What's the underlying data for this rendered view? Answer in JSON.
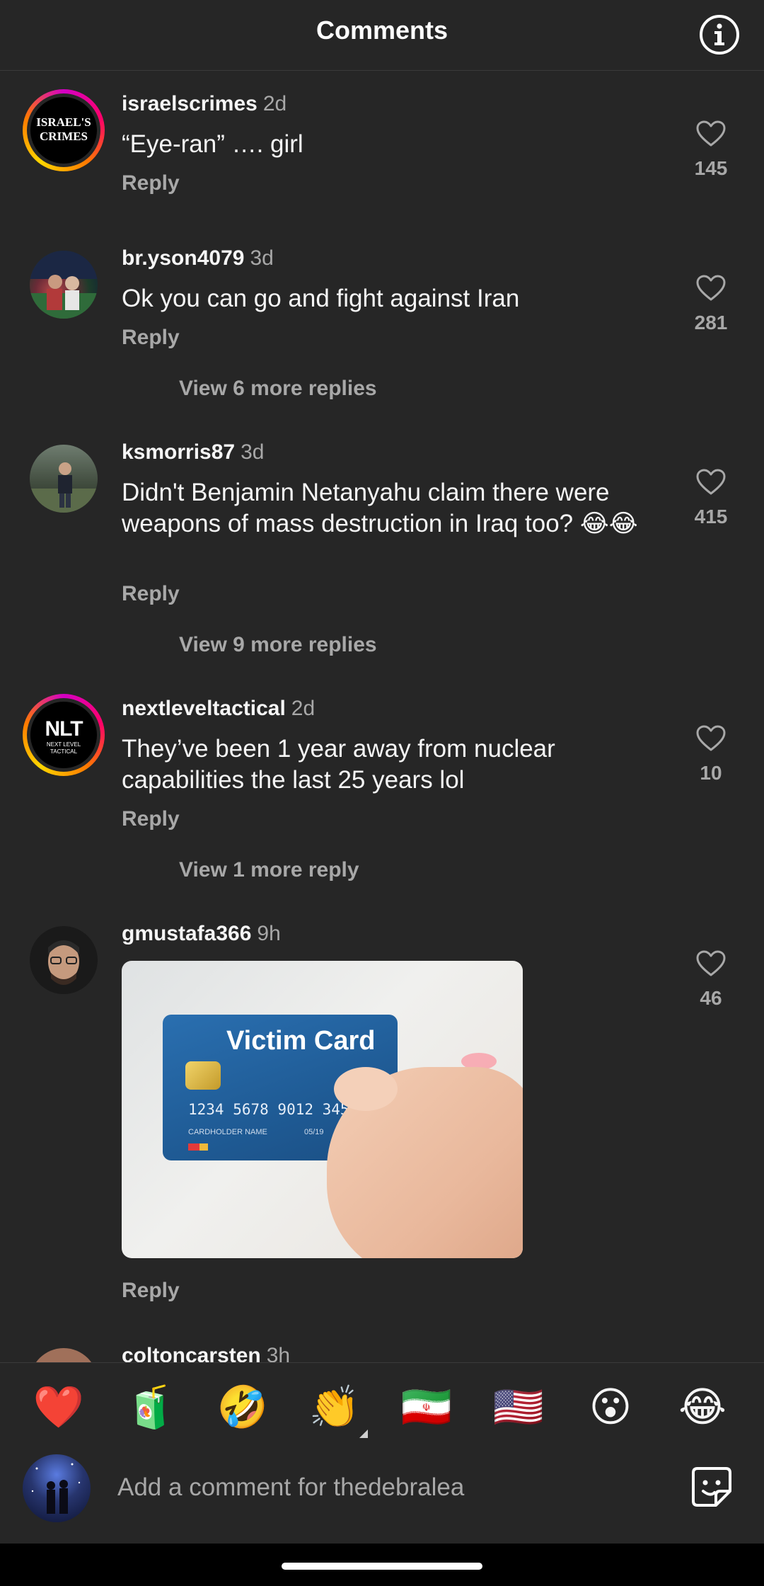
{
  "header": {
    "title": "Comments",
    "info_icon": "info-icon"
  },
  "comments": [
    {
      "user": "israelscrimes",
      "time": "2d",
      "text": "“Eye-ran” …. girl",
      "reply": "Reply",
      "likes": "145",
      "avatar_text": "ISRAEL'S CRIMES"
    },
    {
      "user": "br.yson4079",
      "time": "3d",
      "text": "Ok you can go and fight against Iran",
      "reply": "Reply",
      "likes": "281",
      "more": "View 6 more replies"
    },
    {
      "user": "ksmorris87",
      "time": "3d",
      "text": "Didn't Benjamin Netanyahu claim there were weapons of mass destruction in Iraq too? 😂😂",
      "reply": "Reply",
      "likes": "415",
      "more": "View 9 more replies"
    },
    {
      "user": "nextleveltactical",
      "time": "2d",
      "text": "They’ve been 1 year away from nuclear capabilities the last 25 years lol",
      "reply": "Reply",
      "likes": "10",
      "more": "View 1 more reply",
      "avatar_text": "NLT",
      "avatar_sub": "NEXT LEVEL TACTICAL"
    },
    {
      "user": "gmustafa366",
      "time": "9h",
      "reply": "Reply",
      "likes": "46",
      "gif": {
        "card_title": "Victim Card",
        "card_number": "1234 5678 9012 3456",
        "card_holder": "CARDHOLDER NAME",
        "card_exp": "05/19"
      }
    },
    {
      "user": "coltoncarsten",
      "time": "3h"
    }
  ],
  "emoji_bar": [
    "❤️",
    "🧃",
    "🤣",
    "👏",
    "🇮🇷",
    "🇺🇸",
    "😮",
    "😂"
  ],
  "composer": {
    "placeholder": "Add a comment for thedebralea",
    "sticker_icon": "sticker-icon"
  }
}
